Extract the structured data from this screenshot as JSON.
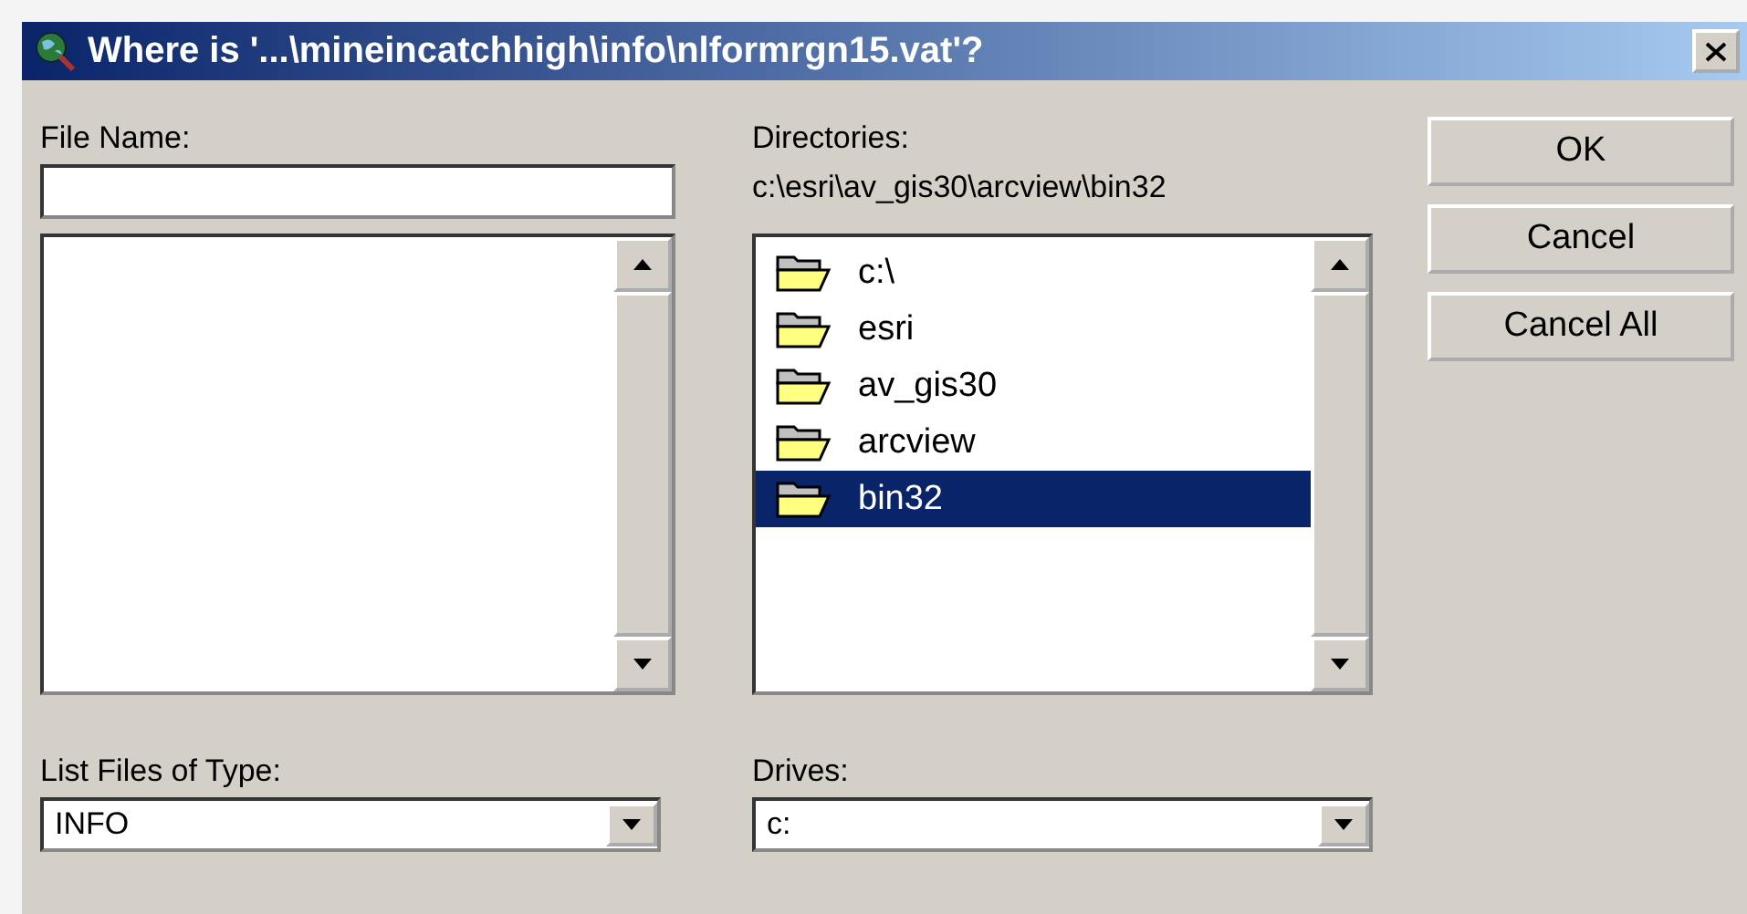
{
  "window": {
    "title": "Where is '...\\mineincatchhigh\\info\\nlformrgn15.vat'?"
  },
  "file_name": {
    "label": "File Name:"
  },
  "directories": {
    "label": "Directories:",
    "path": "c:\\esri\\av_gis30\\arcview\\bin32",
    "items": [
      {
        "name": "c:\\",
        "selected": false
      },
      {
        "name": "esri",
        "selected": false
      },
      {
        "name": "av_gis30",
        "selected": false
      },
      {
        "name": "arcview",
        "selected": false
      },
      {
        "name": "bin32",
        "selected": true
      }
    ]
  },
  "file_type": {
    "label": "List Files of Type:",
    "value": "INFO"
  },
  "drives": {
    "label": "Drives:",
    "value": "c:"
  },
  "buttons": [
    "OK",
    "Cancel",
    "Cancel All"
  ]
}
